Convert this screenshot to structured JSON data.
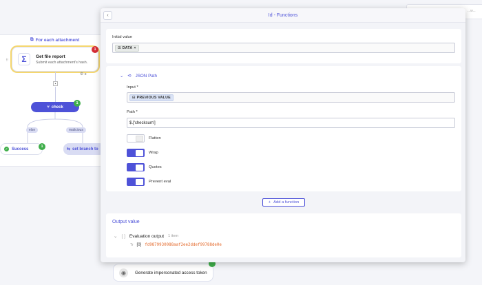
{
  "canvas": {
    "topright_text": "...w...",
    "foreach_label": "For each attachment",
    "file_node": {
      "title": "Get file report",
      "subtitle": "Submit each attachment's hash.",
      "badge": "1"
    },
    "check_node": {
      "label": "check",
      "badge": "1"
    },
    "branch_else": "else",
    "branch_malicious": "malicious",
    "success_node": {
      "label": "Success",
      "badge": "1"
    },
    "branch_node": {
      "label": "set branch to"
    },
    "token_node": {
      "label": "Generate impersonated access token"
    }
  },
  "modal": {
    "title": "Id - Functions",
    "initial_value": {
      "label": "Initial value",
      "chip": "DATA"
    },
    "json_path": {
      "header": "JSON Path",
      "input": {
        "label": "Input *",
        "chip": "PREVIOUS VALUE"
      },
      "path": {
        "label": "Path *",
        "value": "$.['checksum']"
      },
      "toggles": [
        {
          "label": "Flatten",
          "on": false
        },
        {
          "label": "Wrap",
          "on": true
        },
        {
          "label": "Quotes",
          "on": true
        },
        {
          "label": "Prevent eval",
          "on": true
        }
      ]
    },
    "add_function_label": "Add a function",
    "output": {
      "title": "Output value",
      "eval_label": "Evaluation output",
      "eval_meta": "1 item",
      "result_type": "Tr",
      "result_index": "[0]",
      "result_value": "fd9879930088aaf2ee2ddef99788de0e"
    }
  },
  "colors": {
    "accent": "#4a4fd8",
    "success": "#3fae4a",
    "error": "#d62c35",
    "value": "#e46a2c"
  }
}
